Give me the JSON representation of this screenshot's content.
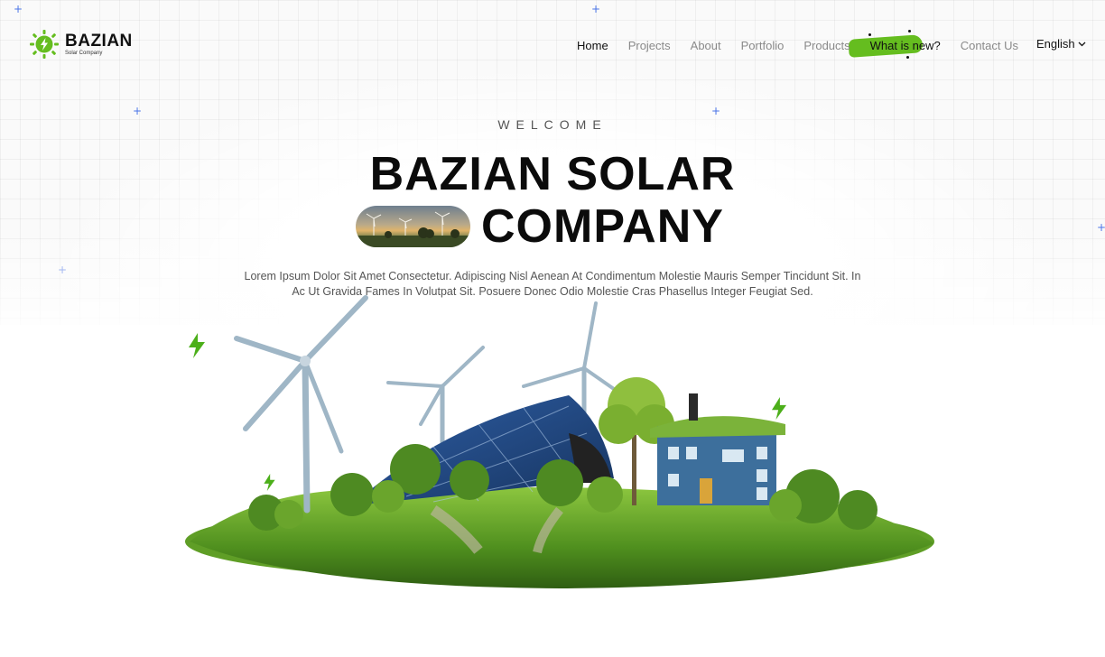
{
  "brand": {
    "name": "BAZIAN",
    "tagline": "Solar Company",
    "accent_color": "#65bd1f"
  },
  "nav": {
    "items": [
      {
        "label": "Home",
        "state": "active"
      },
      {
        "label": "Projects",
        "state": "default"
      },
      {
        "label": "About",
        "state": "default"
      },
      {
        "label": "Portfolio",
        "state": "default"
      },
      {
        "label": "Products",
        "state": "default"
      },
      {
        "label": "What is new?",
        "state": "highlighted"
      },
      {
        "label": "Contact Us",
        "state": "default"
      }
    ],
    "language": "English",
    "language_icon": "chevron-down-icon"
  },
  "hero": {
    "eyebrow": "WELCOME",
    "title_line1": "BAZIAN SOLAR",
    "title_line2": "COMPANY",
    "title_image_icon": "wind-turbines-sunset-image",
    "description": "Lorem Ipsum Dolor Sit Amet Consectetur. Adipiscing Nisl Aenean At Condimentum Molestie Mauris Semper Tincidunt Sit. In Ac Ut Gravida Fames In Volutpat Sit. Posuere Donec Odio Molestie Cras Phasellus Integer Feugiat Sed.",
    "illustration_icon": "renewable-energy-island-illustration"
  },
  "decor": {
    "plus_icon": "plus-icon",
    "bolt_icon": "lightning-bolt-icon",
    "bolt_color": "#4caf1a",
    "plus_color": "#4a74e8"
  }
}
